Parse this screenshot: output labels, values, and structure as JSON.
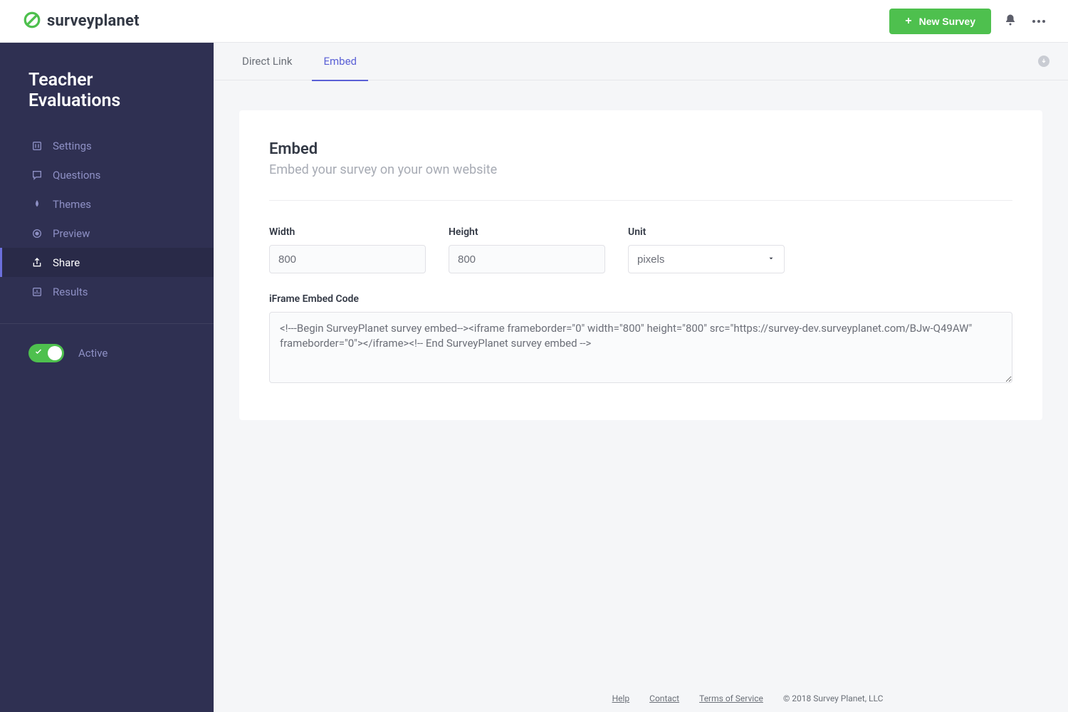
{
  "brand": {
    "name": "surveyplanet"
  },
  "topbar": {
    "new_survey_label": "New Survey"
  },
  "sidebar": {
    "survey_title": "Teacher Evaluations",
    "items": [
      {
        "label": "Settings"
      },
      {
        "label": "Questions"
      },
      {
        "label": "Themes"
      },
      {
        "label": "Preview"
      },
      {
        "label": "Share"
      },
      {
        "label": "Results"
      }
    ],
    "status": {
      "label": "Active",
      "on": true
    }
  },
  "subtabs": {
    "items": [
      {
        "label": "Direct Link",
        "active": false
      },
      {
        "label": "Embed",
        "active": true
      }
    ]
  },
  "panel": {
    "title": "Embed",
    "subtitle": "Embed your survey on your own website",
    "fields": {
      "width_label": "Width",
      "width_value": "800",
      "height_label": "Height",
      "height_value": "800",
      "unit_label": "Unit",
      "unit_value": "pixels"
    },
    "code_label": "iFrame Embed Code",
    "code_value": "<!---Begin SurveyPlanet survey embed--><iframe frameborder=\"0\" width=\"800\" height=\"800\" src=\"https://survey-dev.surveyplanet.com/BJw-Q49AW\" frameborder=\"0\"></iframe><!-- End SurveyPlanet survey embed -->"
  },
  "footer": {
    "links": [
      {
        "label": "Help"
      },
      {
        "label": "Contact"
      },
      {
        "label": "Terms of Service"
      }
    ],
    "copyright": "© 2018 Survey Planet, LLC"
  }
}
